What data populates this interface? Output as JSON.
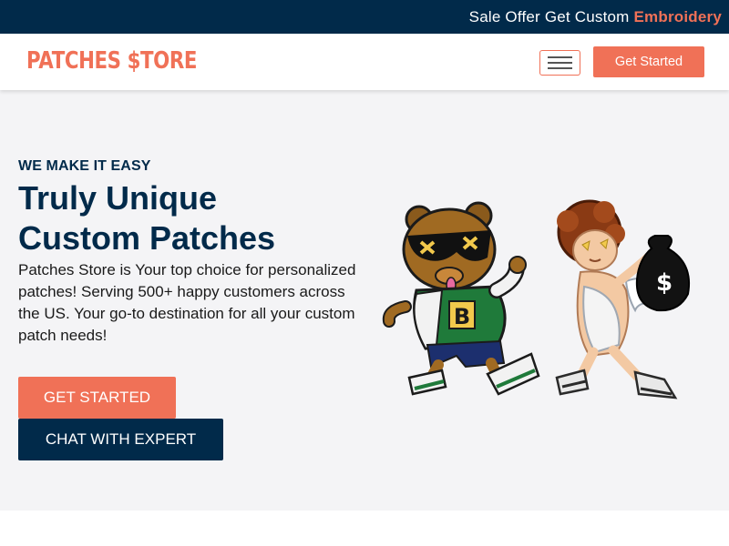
{
  "announcement": {
    "text": "Sale Offer Get Custom",
    "highlight": "Embroidery"
  },
  "header": {
    "logo": "PATCHES $TORE",
    "cta_label": "Get Started"
  },
  "hero": {
    "eyebrow": "WE MAKE IT EASY",
    "headline_line1": "Truly Unique",
    "headline_line2": "Custom Patches",
    "description": "Patches Store is Your top choice for personalized patches! Serving 500+ happy customers across the US. Your go-to destination for all your custom patch needs!",
    "primary_button": "GET STARTED",
    "secondary_button": "CHAT WITH EXPERT"
  },
  "colors": {
    "navy": "#012a4a",
    "accent": "#f07157",
    "hero_bg": "#f4f4f6"
  }
}
